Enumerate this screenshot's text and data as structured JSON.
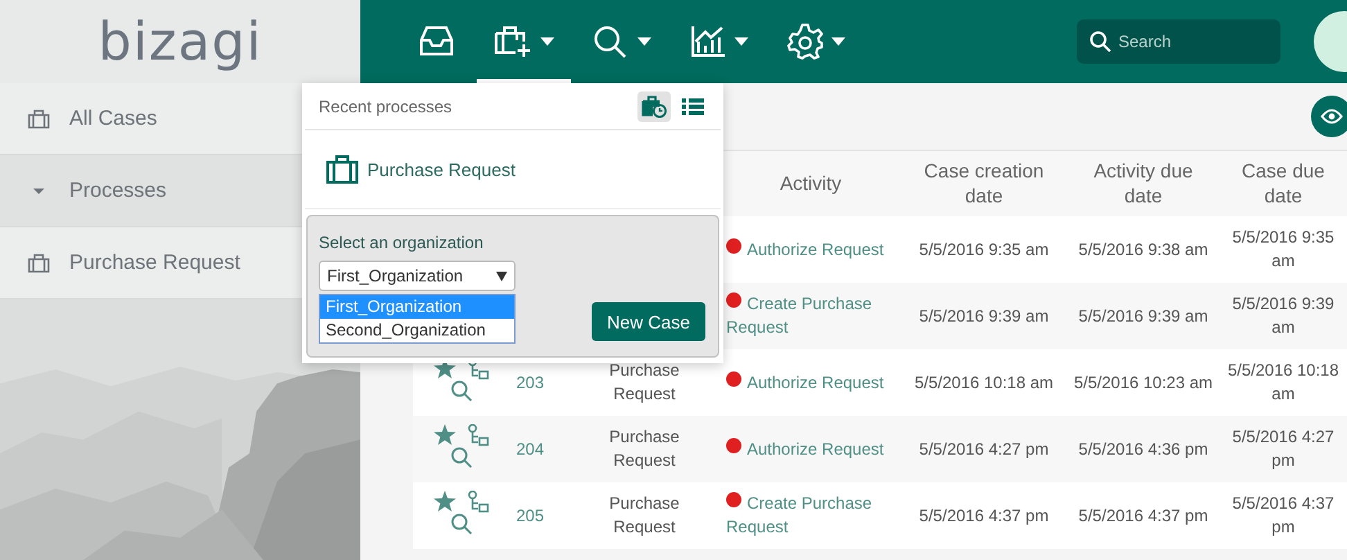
{
  "logo": "bizagi",
  "nav": [
    {
      "kind": "inbox",
      "caret": false,
      "selected": false
    },
    {
      "kind": "new-case",
      "caret": true,
      "selected": true
    },
    {
      "kind": "search",
      "caret": true,
      "selected": false
    },
    {
      "kind": "chart",
      "caret": true,
      "selected": false
    },
    {
      "kind": "settings",
      "caret": true,
      "selected": false
    }
  ],
  "search": {
    "placeholder": "Search"
  },
  "sidebar": {
    "items": [
      {
        "label": "All Cases",
        "kind": "case",
        "selected": false
      },
      {
        "label": "Processes",
        "kind": "group",
        "selected": true,
        "expanded": true
      },
      {
        "label": "Purchase Request",
        "kind": "case",
        "selected": false
      }
    ]
  },
  "table": {
    "columns": [
      "Activity",
      "Case creation date",
      "Activity due date",
      "Case due date"
    ],
    "rows": [
      {
        "activity": "Authorize Request",
        "created": "5/5/2016 9:35 am",
        "activity_due": "5/5/2016 9:38 am",
        "case_due": "5/5/2016 9:35 am"
      },
      {
        "activity": "Create Purchase Request",
        "created": "5/5/2016 9:39 am",
        "activity_due": "5/5/2016 9:39 am",
        "case_due": "5/5/2016 9:39 am"
      },
      {
        "case_id": "203",
        "process": "Purchase Request",
        "activity": "Authorize Request",
        "created": "5/5/2016 10:18 am",
        "activity_due": "5/5/2016 10:23 am",
        "case_due": "5/5/2016 10:18 am"
      },
      {
        "case_id": "204",
        "process": "Purchase Request",
        "activity": "Authorize Request",
        "created": "5/5/2016 4:27 pm",
        "activity_due": "5/5/2016 4:36 pm",
        "case_due": "5/5/2016 4:27 pm"
      },
      {
        "case_id": "205",
        "process": "Purchase Request",
        "activity": "Create Purchase Request",
        "created": "5/5/2016 4:37 pm",
        "activity_due": "5/5/2016 4:37 pm",
        "case_due": "5/5/2016 4:37 pm"
      }
    ]
  },
  "popup": {
    "title": "Recent processes",
    "views": [
      {
        "kind": "recent",
        "selected": true
      },
      {
        "kind": "list",
        "selected": false
      }
    ],
    "process": "Purchase Request",
    "org_label": "Select an organization",
    "org_value": "First_Organization",
    "options": [
      {
        "label": "First_Organization",
        "selected": true
      },
      {
        "label": "Second_Organization",
        "selected": false
      }
    ],
    "button": "New Case"
  }
}
